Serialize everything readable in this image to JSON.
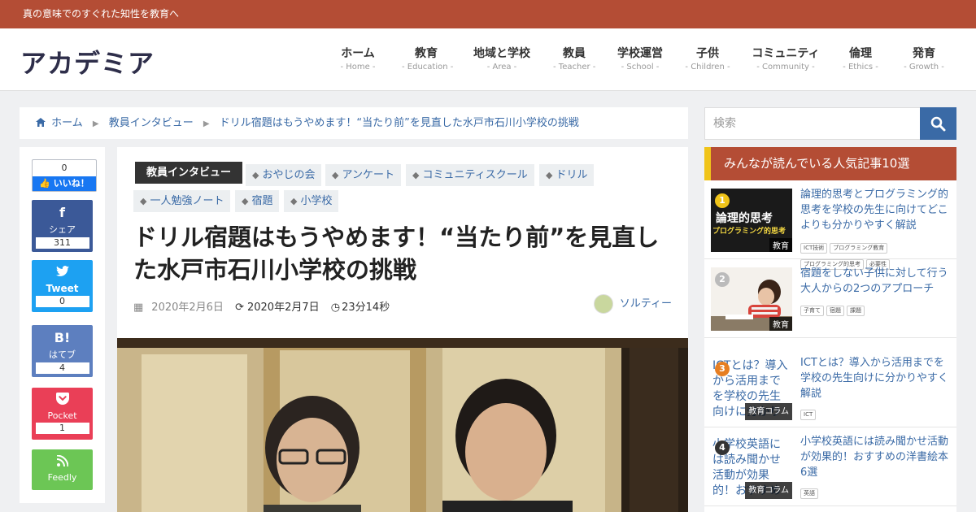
{
  "topbar": {
    "tagline": "真の意味でのすぐれた知性を教育へ"
  },
  "header": {
    "logo": "アカデミア"
  },
  "nav": [
    {
      "label": "ホーム",
      "sub": "- Home -"
    },
    {
      "label": "教育",
      "sub": "- Education -"
    },
    {
      "label": "地域と学校",
      "sub": "- Area -"
    },
    {
      "label": "教員",
      "sub": "- Teacher -"
    },
    {
      "label": "学校運営",
      "sub": "- School -"
    },
    {
      "label": "子供",
      "sub": "- Children -"
    },
    {
      "label": "コミュニティ",
      "sub": "- Community -"
    },
    {
      "label": "倫理",
      "sub": "- Ethics -"
    },
    {
      "label": "発育",
      "sub": "- Growth -"
    }
  ],
  "breadcrumb": {
    "home": "ホーム",
    "category": "教員インタビュー",
    "current": "ドリル宿題はもうやめます！“当たり前”を見直した水戸市石川小学校の挑戦"
  },
  "share": {
    "like": {
      "count": "0",
      "label": "いいね！"
    },
    "facebook": {
      "icon": "f",
      "label": "シェア",
      "count": "311"
    },
    "twitter": {
      "label": "Tweet",
      "count": "0"
    },
    "hatena": {
      "icon": "B!",
      "label": "はてブ",
      "count": "4"
    },
    "pocket": {
      "label": "Pocket",
      "count": "1"
    },
    "feedly": {
      "label": "Feedly"
    }
  },
  "article": {
    "category": "教員インタビュー",
    "tags": [
      "おやじの会",
      "アンケート",
      "コミュニティスクール",
      "ドリル",
      "一人勉強ノート",
      "宿題",
      "小学校"
    ],
    "title": "ドリル宿題はもうやめます！“当たり前”を見直した水戸市石川小学校の挑戦",
    "published": "2020年2月6日",
    "updated": "2020年2月7日",
    "reading_time": "23分14秒",
    "author": "ソルティー"
  },
  "search": {
    "placeholder": "検索"
  },
  "sidebar": {
    "popular_title": "みんなが読んでいる人気記事10選",
    "items": [
      {
        "rank": "1",
        "title": "論理的思考とプログラミング的思考を学校の先生に向けてどこよりも分かりやすく解説",
        "thumb_category": "教育",
        "thumb_text": "論理的思考",
        "thumb_sub": "プログラミング的思考",
        "tags": [
          "ICT技術",
          "プログラミング教育",
          "プログラミング的思考",
          "必要性"
        ],
        "rank_color": "#f0c419"
      },
      {
        "rank": "2",
        "title": "宿題をしない子供に対して行う大人からの2つのアプローチ",
        "thumb_category": "教育",
        "tags": [
          "子育て",
          "宿題",
          "課題"
        ],
        "rank_color": "#bbbbbb"
      },
      {
        "rank": "3",
        "title": "ICTとは？導入から活用までを学校の先生向けに分かりやすく解説",
        "thumb_category": "教育コラム",
        "thumb_text": "ICTとは？導入から活用までを学校の先生向けに分かりやすく解説",
        "tags": [
          "ICT"
        ],
        "rank_color": "#e67e22"
      },
      {
        "rank": "4",
        "title": "小学校英語には読み聞かせ活動が効果的！おすすめの洋書絵本6選",
        "thumb_category": "教育コラム",
        "thumb_text": "小学校英語には読み聞かせ活動が効果的！おすすめの洋書絵本6選",
        "tags": [
          "英語"
        ],
        "rank_color": "#333333"
      }
    ]
  },
  "colors": {
    "brand": "#b44d35",
    "link": "#3a6aa6",
    "accent": "#f0c419"
  }
}
